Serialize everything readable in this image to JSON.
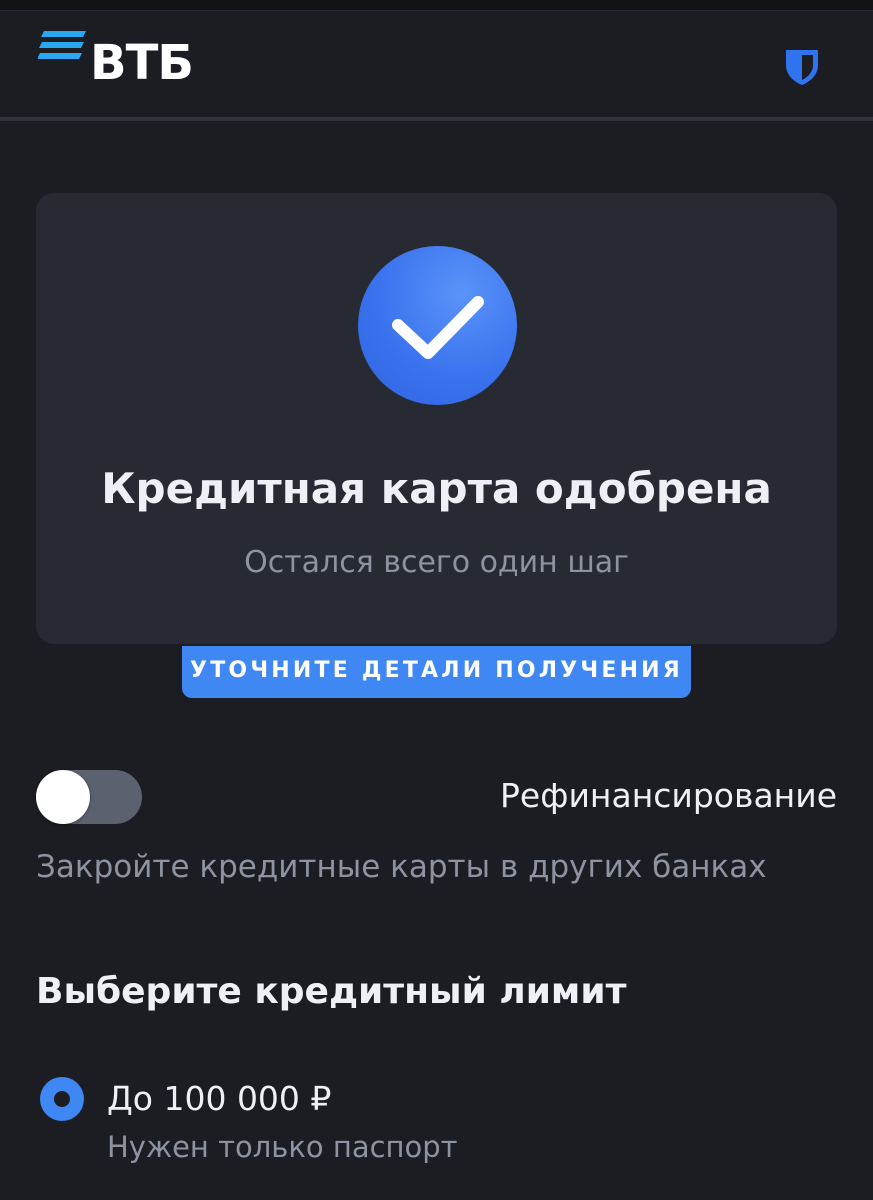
{
  "header": {
    "logo_text": "ВТБ",
    "brand_color": "#2aa6f2",
    "shield_icon": "shield-icon",
    "shield_color": "#2f73ee"
  },
  "approval_card": {
    "icon": "checkmark-icon",
    "title": "Кредитная карта одобрена",
    "subtitle": "Остался всего один шаг"
  },
  "details_button": {
    "label": "УТОЧНИТЕ ДЕТАЛИ ПОЛУЧЕНИЯ",
    "color": "#3f87f2"
  },
  "refinancing": {
    "label": "Рефинансирование",
    "description": "Закройте кредитные карты в других банках",
    "enabled": false
  },
  "credit_limit": {
    "title": "Выберите кредитный лимит",
    "options": [
      {
        "label": "До 100 000 ₽",
        "description": "Нужен только паспорт",
        "selected": true
      }
    ]
  }
}
